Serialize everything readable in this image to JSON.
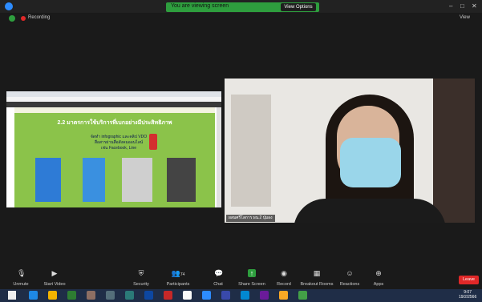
{
  "share_banner": {
    "text": "You are viewing screen",
    "view_options": "View Options"
  },
  "status": {
    "recording": "Recording",
    "view": "View"
  },
  "slide": {
    "title": "2.2 มาตรการใช้บริการที่เบกอย่างมีประสิทธิภาพ",
    "lines": [
      "จัดทำ infographic และคลิป VDO",
      "สื่อสารผ่านสื่อสังคมออนไลน์",
      "เช่น Facebook, Line"
    ]
  },
  "participant": {
    "name": "ผสมศรี่โลการ ผน.2 ปุ่มอง"
  },
  "toolbar": {
    "unmute": "Unmute",
    "start_video": "Start Video",
    "security": "Security",
    "participants": "Participants",
    "participants_count": "74",
    "chat": "Chat",
    "share_screen": "Share Screen",
    "record": "Record",
    "breakout_rooms": "Breakout Rooms",
    "reactions": "Reactions",
    "apps": "Apps",
    "leave": "Leave"
  },
  "taskbar": {
    "time": "9:07",
    "date": "19/2/2566"
  },
  "colors": {
    "banner": "#2e9e3e",
    "leave": "#e02828",
    "slide_bg": "#8bc34a",
    "mask": "#9ad6ea"
  }
}
